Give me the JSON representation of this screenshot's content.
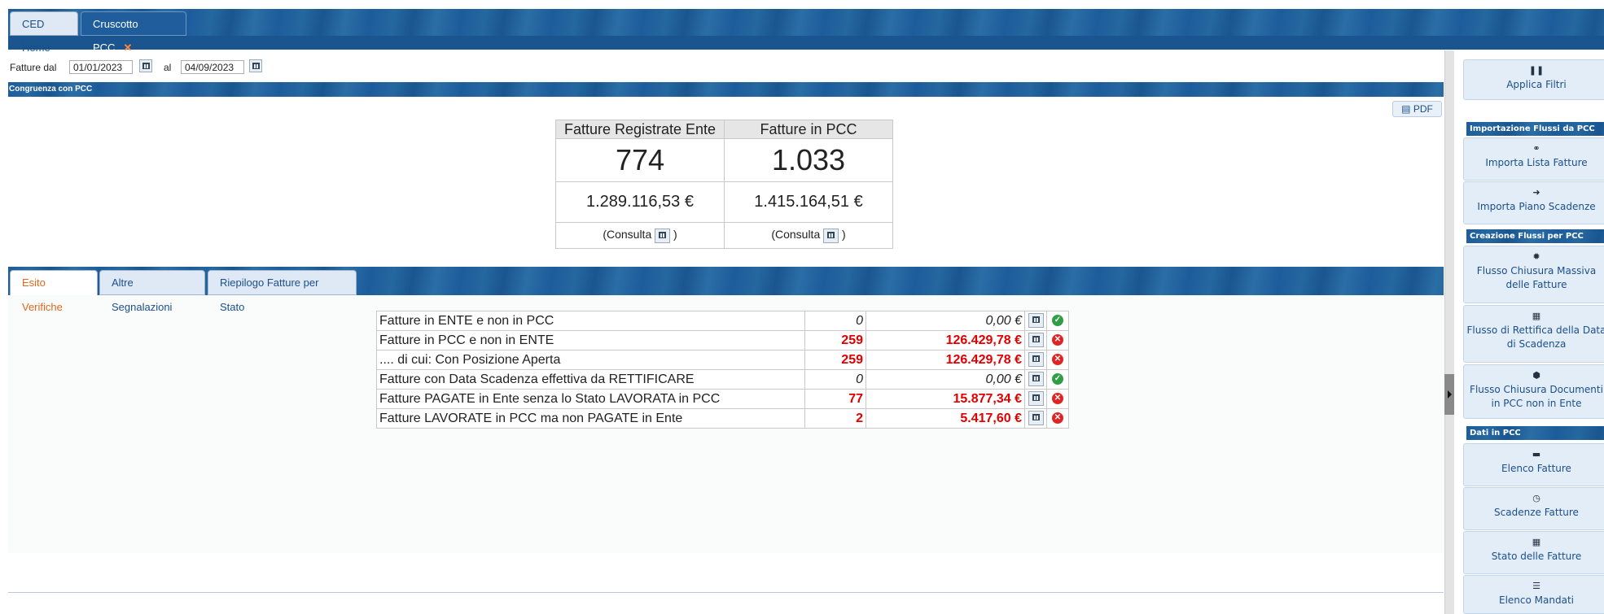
{
  "tabs": {
    "home": "CED Home",
    "cruscotto": "Cruscotto PCC",
    "close": "✕"
  },
  "filters": {
    "from_label": "Fatture dal",
    "from_value": "01/01/2023",
    "to_label": "al",
    "to_value": "04/09/2023"
  },
  "section_congruenza": {
    "title": "Congruenza con PCC",
    "pdf": "PDF"
  },
  "congruenza": {
    "headers": [
      "Fatture Registrate Ente",
      "Fatture in PCC"
    ],
    "counts": [
      "774",
      "1.033"
    ],
    "amounts": [
      "1.289.116,53 €",
      "1.415.164,51 €"
    ],
    "consulta_open": "(Consulta",
    "consulta_close": ")"
  },
  "verify_tabs": [
    "Esito Verifiche",
    "Altre Segnalazioni",
    "Riepilogo Fatture per Stato"
  ],
  "esito_rows": [
    {
      "label": "Fatture in ENTE e non in PCC",
      "count": "0",
      "amount": "0,00 €",
      "status": "ok"
    },
    {
      "label": "Fatture in PCC e non in ENTE",
      "count": "259",
      "amount": "126.429,78 €",
      "status": "error"
    },
    {
      "label": ".... di cui: Con Posizione Aperta",
      "count": "259",
      "amount": "126.429,78 €",
      "status": "error"
    },
    {
      "label": "Fatture con Data Scadenza effettiva da RETTIFICARE",
      "count": "0",
      "amount": "0,00 €",
      "status": "ok"
    },
    {
      "label": "Fatture PAGATE in Ente senza lo Stato LAVORATA in PCC",
      "count": "77",
      "amount": "15.877,34 €",
      "status": "error"
    },
    {
      "label": "Fatture LAVORATE in PCC ma non PAGATE in Ente",
      "count": "2",
      "amount": "5.417,60 €",
      "status": "error"
    }
  ],
  "sidebar": {
    "apply": "Applica Filtri",
    "hdr_import": "Importazione Flussi da PCC",
    "import_list": "Importa Lista Fatture",
    "import_plan": "Importa Piano Scadenze",
    "hdr_create": "Creazione Flussi per PCC",
    "flow_close_1": "Flusso Chiusura Massiva",
    "flow_close_2": "delle Fatture",
    "flow_rect_1": "Flusso di Rettifica della Data",
    "flow_rect_2": "di Scadenza",
    "flow_docs_1": "Flusso Chiusura Documenti",
    "flow_docs_2": "in PCC non in Ente",
    "hdr_data": "Dati in PCC",
    "list_invoices": "Elenco Fatture",
    "deadlines": "Scadenze Fatture",
    "status": "Stato delle Fatture",
    "mandates": "Elenco Mandati"
  },
  "colors": {
    "accent_blue": "#1d5c9b",
    "error_red": "#e00000",
    "ok_green": "#2f9e44",
    "active_tab_orange": "#e2681c"
  }
}
